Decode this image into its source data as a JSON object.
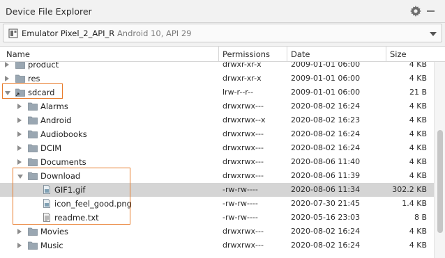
{
  "panel": {
    "title": "Device File Explorer",
    "settings_icon": "gear-icon",
    "minimize_icon": "minimize-icon"
  },
  "device": {
    "name": "Emulator Pixel_2_API_R",
    "details": "Android 10, API 29",
    "icon": "phone-icon"
  },
  "columns": {
    "name": "Name",
    "permissions": "Permissions",
    "date": "Date",
    "size": "Size"
  },
  "rows": [
    {
      "name": "product",
      "perm": "drwxr-xr-x",
      "date": "2009-01-01 06:00",
      "size": "4 KB",
      "kind": "folder",
      "state": "collapsed",
      "level": 0
    },
    {
      "name": "res",
      "perm": "drwxr-xr-x",
      "date": "2009-01-01 06:00",
      "size": "4 KB",
      "kind": "folder",
      "state": "collapsed",
      "level": 0
    },
    {
      "name": "sdcard",
      "perm": "lrw-r--r--",
      "date": "2009-01-01 06:00",
      "size": "21 B",
      "kind": "link-folder",
      "state": "expanded",
      "level": 0
    },
    {
      "name": "Alarms",
      "perm": "drwxrwx---",
      "date": "2020-08-02 16:24",
      "size": "4 KB",
      "kind": "folder",
      "state": "collapsed",
      "level": 1
    },
    {
      "name": "Android",
      "perm": "drwxrwx--x",
      "date": "2020-08-02 16:23",
      "size": "4 KB",
      "kind": "folder",
      "state": "collapsed",
      "level": 1
    },
    {
      "name": "Audiobooks",
      "perm": "drwxrwx---",
      "date": "2020-08-02 16:24",
      "size": "4 KB",
      "kind": "folder",
      "state": "collapsed",
      "level": 1
    },
    {
      "name": "DCIM",
      "perm": "drwxrwx---",
      "date": "2020-08-02 16:24",
      "size": "4 KB",
      "kind": "folder",
      "state": "collapsed",
      "level": 1
    },
    {
      "name": "Documents",
      "perm": "drwxrwx---",
      "date": "2020-08-06 11:40",
      "size": "4 KB",
      "kind": "folder",
      "state": "collapsed",
      "level": 1
    },
    {
      "name": "Download",
      "perm": "drwxrwx---",
      "date": "2020-08-06 11:39",
      "size": "4 KB",
      "kind": "folder",
      "state": "expanded",
      "level": 1
    },
    {
      "name": "GIF1.gif",
      "perm": "-rw-rw----",
      "date": "2020-08-06 11:34",
      "size": "302.2 KB",
      "kind": "image-file",
      "state": "none",
      "level": 2,
      "selected": true
    },
    {
      "name": "icon_feel_good.png",
      "perm": "-rw-rw----",
      "date": "2020-07-30 21:45",
      "size": "1.4 KB",
      "kind": "image-file",
      "state": "none",
      "level": 2
    },
    {
      "name": "readme.txt",
      "perm": "-rw-rw----",
      "date": "2020-05-16 23:03",
      "size": "8 B",
      "kind": "text-file",
      "state": "none",
      "level": 2
    },
    {
      "name": "Movies",
      "perm": "drwxrwx---",
      "date": "2020-08-02 16:24",
      "size": "4 KB",
      "kind": "folder",
      "state": "collapsed",
      "level": 1
    },
    {
      "name": "Music",
      "perm": "drwxrwx---",
      "date": "2020-08-02 16:24",
      "size": "4 KB",
      "kind": "folder",
      "state": "collapsed",
      "level": 1
    }
  ],
  "colors": {
    "highlight": "#e87b2a",
    "selection": "#d5d5d5",
    "folder": "#9aa7b2"
  }
}
